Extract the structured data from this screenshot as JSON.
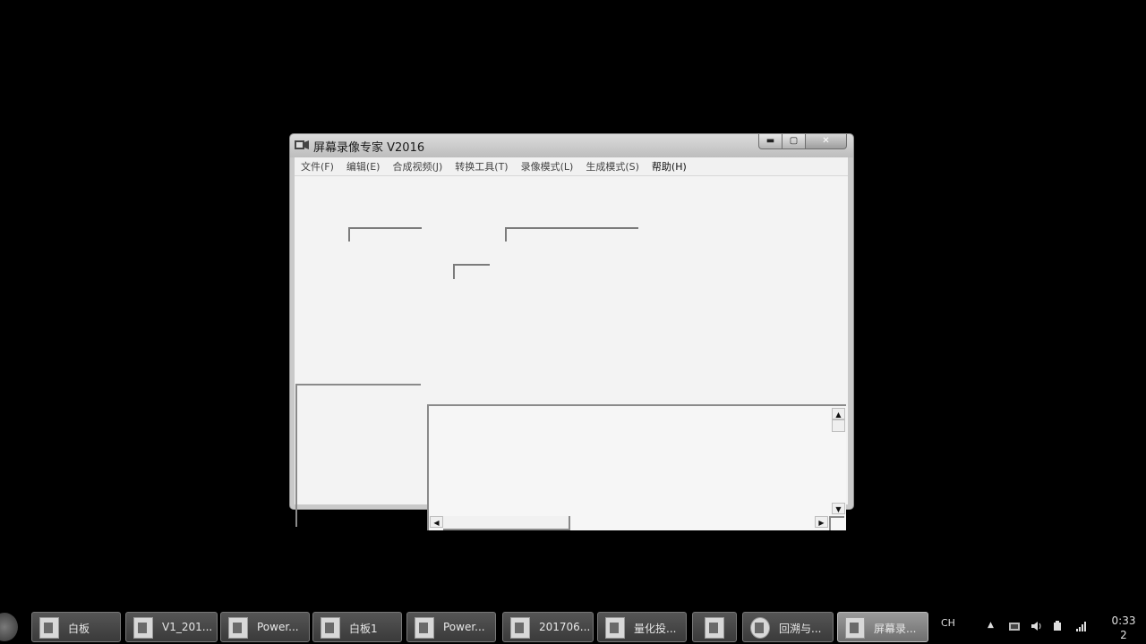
{
  "window": {
    "title": "屏幕录像专家 V2016",
    "buttons": {
      "minimize": "▬",
      "maximize": "▢",
      "close": "✕"
    }
  },
  "menu": [
    "文件(F)",
    "编辑(E)",
    "合成视频(J)",
    "转换工具(T)",
    "录像模式(L)",
    "生成模式(S)",
    "帮助(H)"
  ],
  "scroll": {
    "up": "▲",
    "down": "▼",
    "left": "◀",
    "right": "▶"
  },
  "taskbar": {
    "buttons": [
      {
        "label": "白板",
        "icon": "presentation-icon"
      },
      {
        "label": "V1_201...",
        "icon": "presentation-icon"
      },
      {
        "label": "Power...",
        "icon": "presentation-icon"
      },
      {
        "label": "白板1",
        "icon": "presentation-icon"
      },
      {
        "label": "Power...",
        "icon": "presentation-icon"
      },
      {
        "label": "201706...",
        "icon": "folder-icon"
      },
      {
        "label": "量化投...",
        "icon": "folder-icon"
      },
      {
        "label": "",
        "icon": "app-icon"
      },
      {
        "label": "回溯与...",
        "icon": "browser-icon"
      },
      {
        "label": "屏幕录...",
        "icon": "recorder-icon"
      }
    ],
    "tray": {
      "lang": "CH",
      "arrow": "▲"
    },
    "clock": {
      "time": "0:33",
      "line2": "2"
    }
  },
  "colors": {
    "window_frame": "#c9c9c9",
    "client_bg": "#f3f3f3",
    "taskbar_bg": "#000000"
  }
}
